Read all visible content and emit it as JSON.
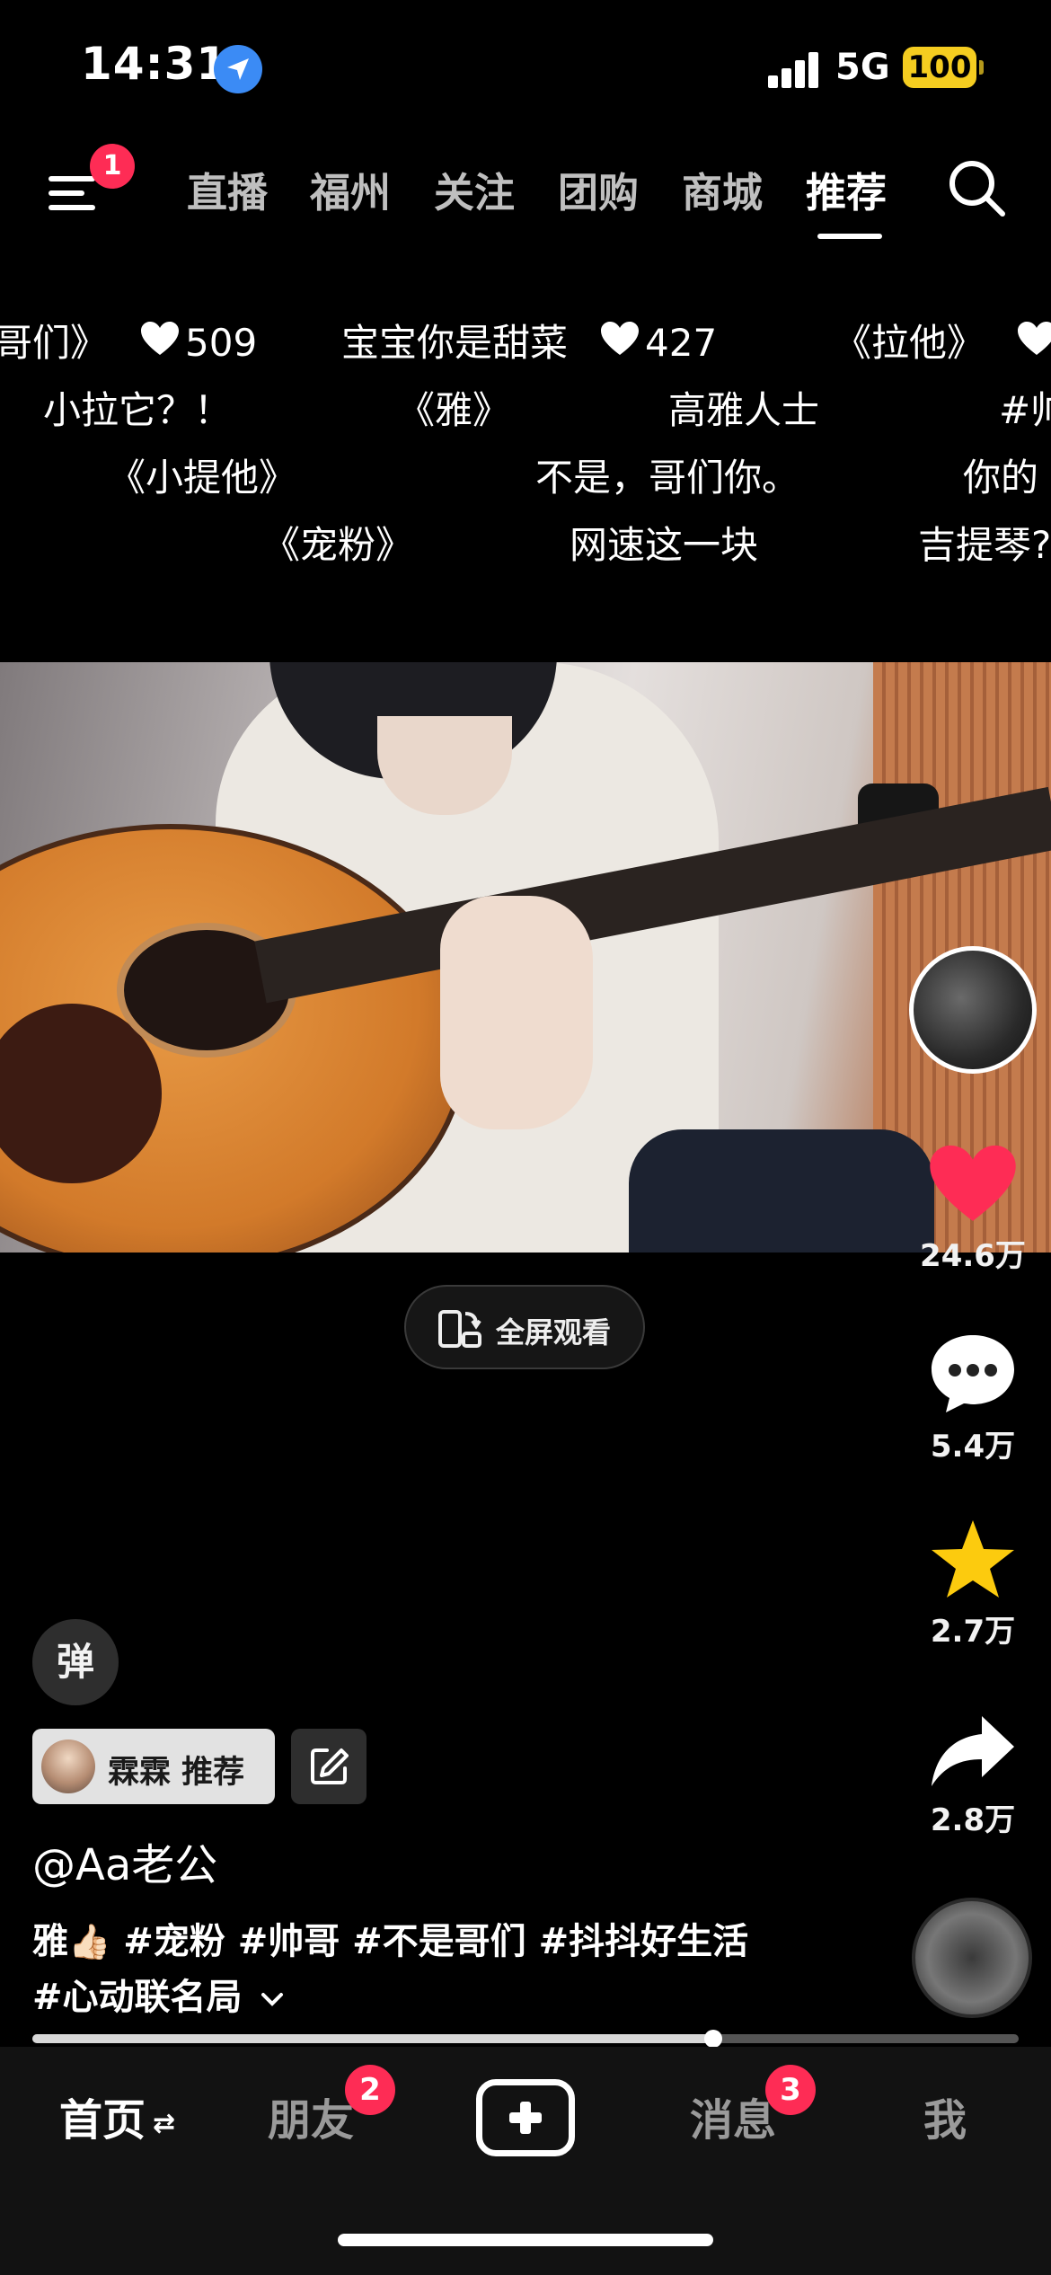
{
  "status_bar": {
    "time": "14:31",
    "network": "5G",
    "battery": "100",
    "location_icon": "location-arrow-icon",
    "battery_color": "#f5cd20"
  },
  "top_nav": {
    "menu_badge": "1",
    "tabs": [
      "直播",
      "福州",
      "关注",
      "团购",
      "商城",
      "推荐"
    ],
    "active_tab": "推荐"
  },
  "danmaku": [
    {
      "text": "哥们》",
      "likes": "509"
    },
    {
      "text": "宝宝你是甜菜",
      "likes": "427"
    },
    {
      "text": "《拉他》"
    },
    {
      "text": "小拉它？！"
    },
    {
      "text": "《雅》"
    },
    {
      "text": "高雅人士"
    },
    {
      "text": "#帅"
    },
    {
      "text": "《小提他》"
    },
    {
      "text": "不是，哥们你。"
    },
    {
      "text": "你的"
    },
    {
      "text": "《宠粉》"
    },
    {
      "text": "网速这一块"
    },
    {
      "text": "吉提琴?"
    }
  ],
  "fullscreen": {
    "label": "全屏观看"
  },
  "rail": {
    "likes": "24.6万",
    "comments": "5.4万",
    "favorites": "2.7万",
    "shares": "2.8万",
    "like_color": "#fe2c55",
    "favorite_color": "#fccb0e"
  },
  "post": {
    "danmu_toggle": "弹",
    "recommend_tag": "霖霖 推荐",
    "author": "@Aa老公",
    "desc_line1_prefix": "雅",
    "desc_line1_emoji": "👍🏻",
    "desc_line1_tags": " #宠粉 #帅哥 #不是哥们 #抖抖好生活",
    "desc_line2": "#心动联名局"
  },
  "progress": {
    "fraction": 0.69
  },
  "tabbar": {
    "home": "首页",
    "friends": "朋友",
    "friends_badge": "2",
    "messages": "消息",
    "messages_badge": "3",
    "me": "我"
  }
}
